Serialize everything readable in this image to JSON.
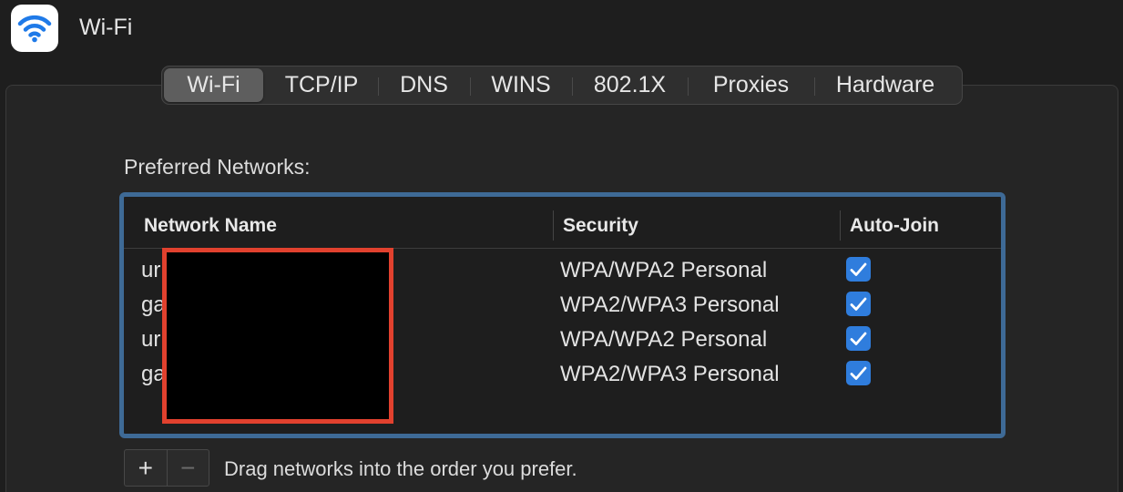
{
  "window": {
    "title": "Wi-Fi",
    "icon": "wifi-icon"
  },
  "tabs": [
    {
      "label": "Wi-Fi",
      "selected": true
    },
    {
      "label": "TCP/IP",
      "selected": false
    },
    {
      "label": "DNS",
      "selected": false
    },
    {
      "label": "WINS",
      "selected": false
    },
    {
      "label": "802.1X",
      "selected": false
    },
    {
      "label": "Proxies",
      "selected": false
    },
    {
      "label": "Hardware",
      "selected": false
    }
  ],
  "preferred": {
    "label": "Preferred Networks:",
    "columns": {
      "name": "Network Name",
      "security": "Security",
      "auto_join": "Auto-Join"
    },
    "rows": [
      {
        "name": "ur",
        "security": "WPA/WPA2 Personal",
        "auto_join": true
      },
      {
        "name": "ga",
        "security": "WPA2/WPA3 Personal",
        "auto_join": true
      },
      {
        "name": "ur",
        "security": "WPA/WPA2 Personal",
        "auto_join": true
      },
      {
        "name": "ga",
        "security": "WPA2/WPA3 Personal",
        "auto_join": true
      }
    ]
  },
  "controls": {
    "add": "+",
    "remove": "−",
    "hint": "Drag networks into the order you prefer."
  },
  "colors": {
    "accent": "#2f7ddd",
    "focus_ring": "#3e6a96",
    "redaction_border": "#e1412e"
  }
}
